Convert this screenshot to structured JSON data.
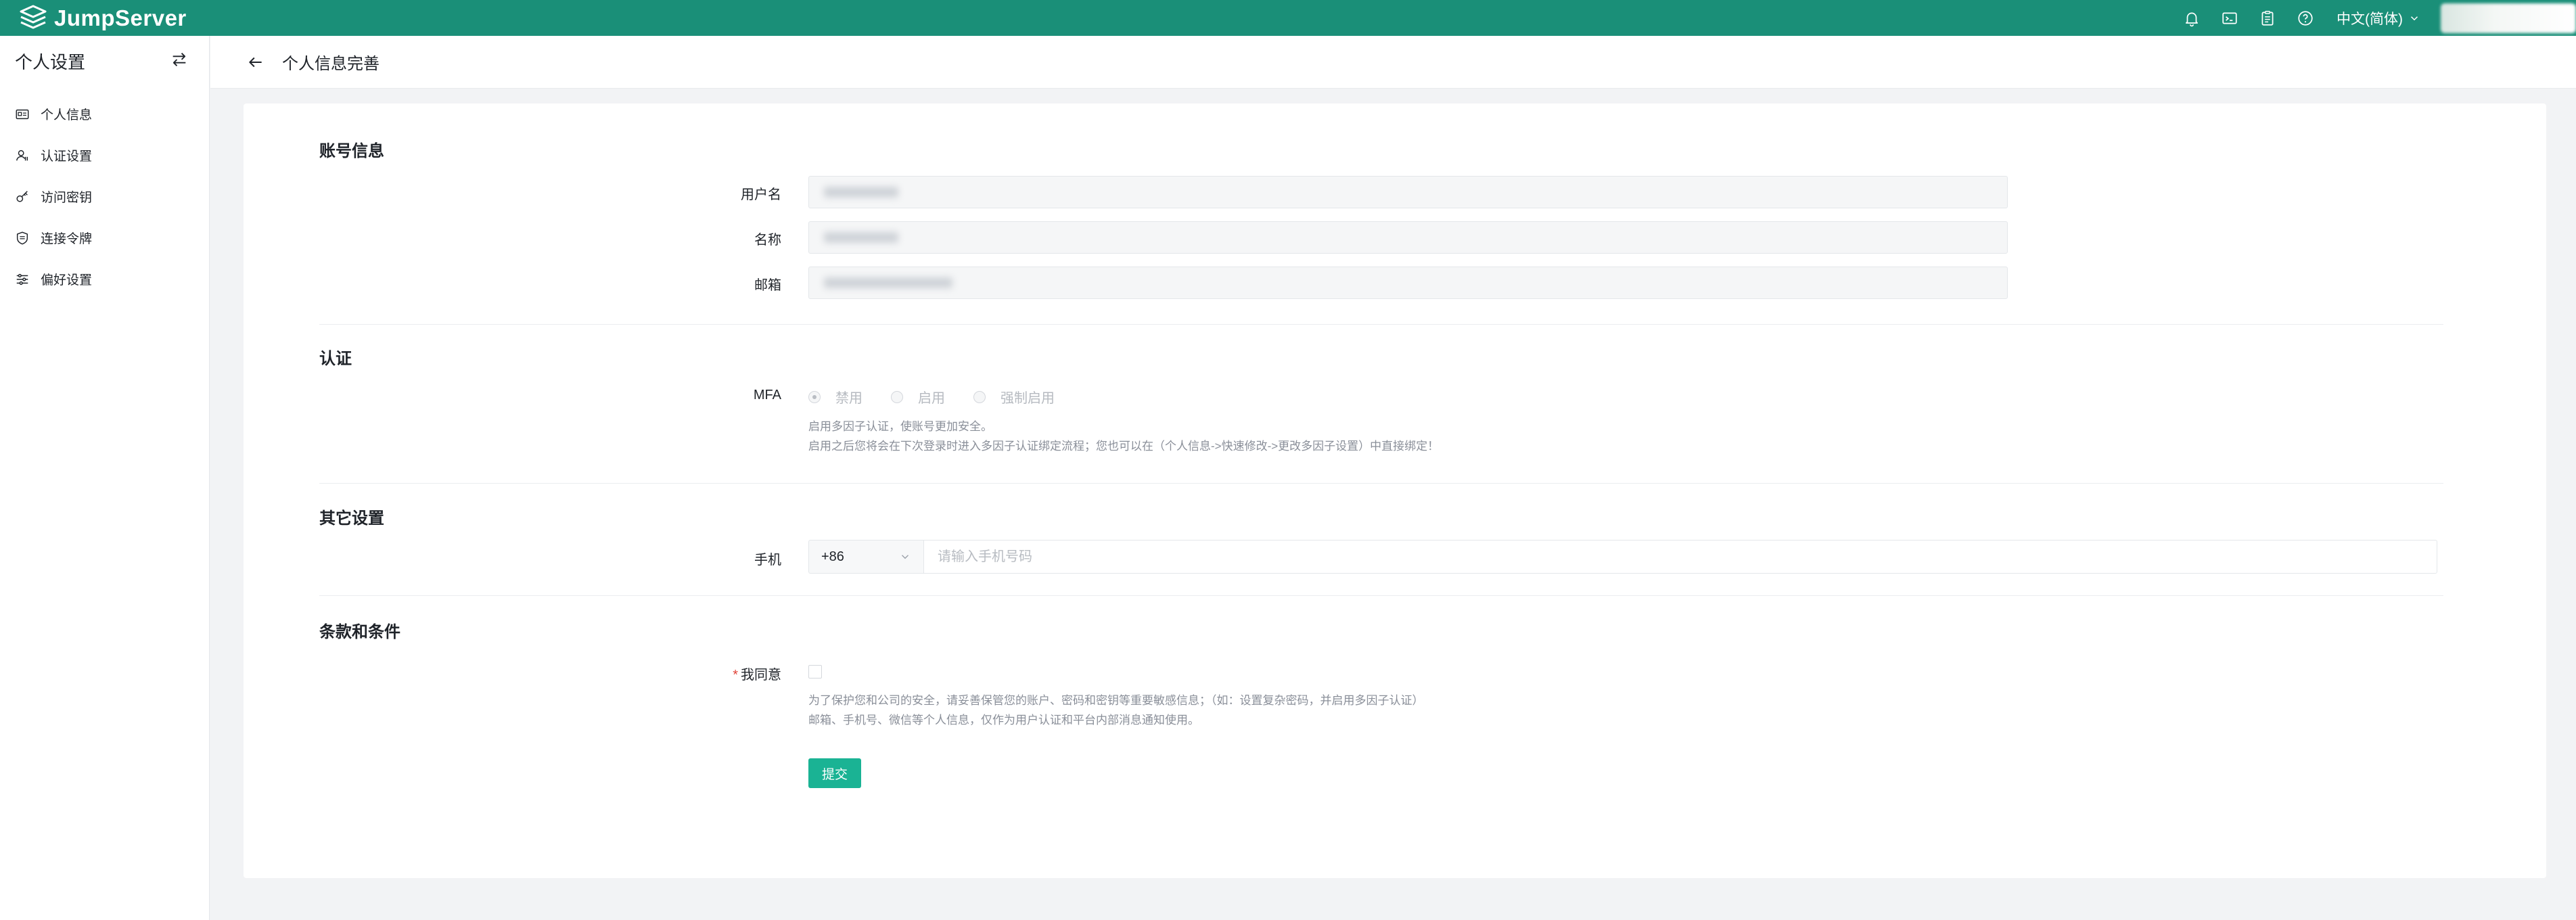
{
  "app": {
    "brand": "JumpServer",
    "brand_color": "#1a8f78",
    "accent_color": "#1ab394"
  },
  "topbar": {
    "icons": [
      "bell-icon",
      "terminal-icon",
      "clipboard-icon",
      "help-icon"
    ],
    "language": "中文(简体)"
  },
  "sidebar": {
    "title": "个人设置",
    "items": [
      {
        "label": "个人信息",
        "icon": "profile-card-icon"
      },
      {
        "label": "认证设置",
        "icon": "user-auth-icon"
      },
      {
        "label": "访问密钥",
        "icon": "key-icon"
      },
      {
        "label": "连接令牌",
        "icon": "token-shield-icon"
      },
      {
        "label": "偏好设置",
        "icon": "sliders-icon"
      }
    ]
  },
  "header": {
    "title": "个人信息完善"
  },
  "form": {
    "account": {
      "title": "账号信息",
      "username_label": "用户名",
      "name_label": "名称",
      "email_label": "邮箱"
    },
    "auth": {
      "title": "认证",
      "mfa_label": "MFA",
      "options": [
        "禁用",
        "启用",
        "强制启用"
      ],
      "selected": "禁用",
      "help_line1": "启用多因子认证，使账号更加安全。",
      "help_line2": "启用之后您将会在下次登录时进入多因子认证绑定流程；您也可以在（个人信息->快速修改->更改多因子设置）中直接绑定！"
    },
    "other": {
      "title": "其它设置",
      "phone_label": "手机",
      "country_code": "+86",
      "phone_placeholder": "请输入手机号码"
    },
    "terms": {
      "title": "条款和条件",
      "required_mark": "*",
      "agree_label": "我同意",
      "agree_checked": false,
      "help_line1": "为了保护您和公司的安全，请妥善保管您的账户、密码和密钥等重要敏感信息；（如：设置复杂密码，并启用多因子认证）",
      "help_line2": "邮箱、手机号、微信等个人信息，仅作为用户认证和平台内部消息通知使用。"
    },
    "submit_label": "提交"
  }
}
